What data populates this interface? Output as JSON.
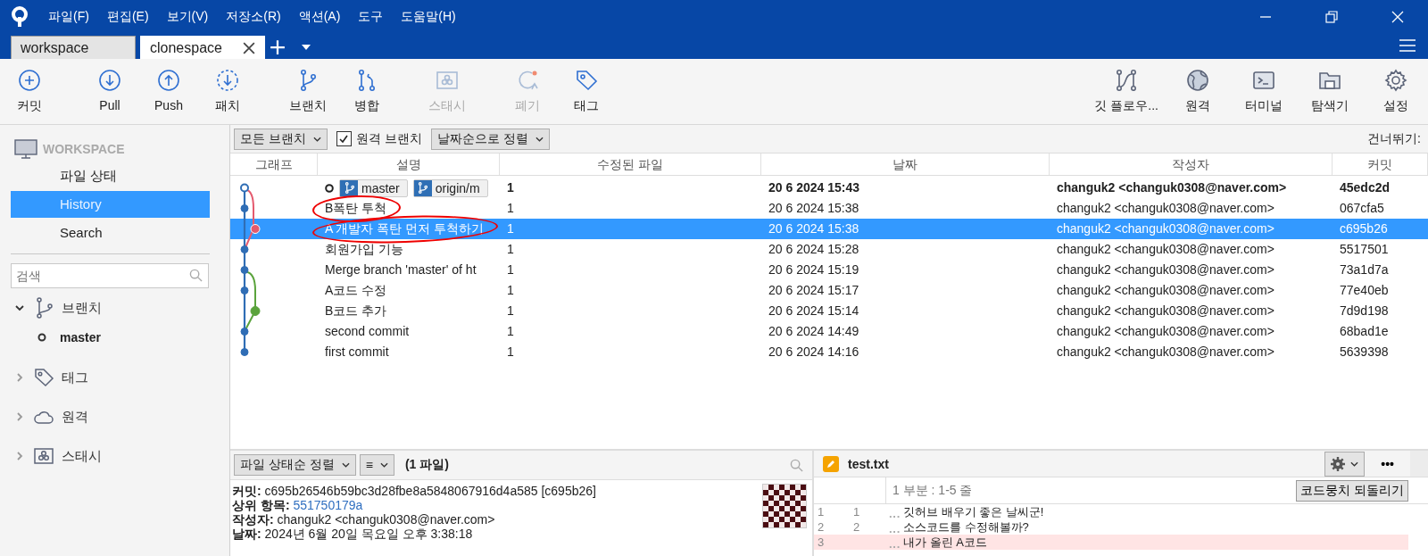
{
  "menu": [
    "파일(F)",
    "편집(E)",
    "보기(V)",
    "저장소(R)",
    "액션(A)",
    "도구",
    "도움말(H)"
  ],
  "tabs": [
    {
      "label": "workspace",
      "selected": false
    },
    {
      "label": "clonespace",
      "selected": true
    }
  ],
  "toolbar_left": [
    {
      "label": "커밋",
      "disabled": false
    },
    {
      "label": "Pull",
      "disabled": false
    },
    {
      "label": "Push",
      "disabled": false
    },
    {
      "label": "패치",
      "disabled": false
    },
    {
      "label": "브랜치",
      "disabled": false
    },
    {
      "label": "병합",
      "disabled": false
    },
    {
      "label": "스태시",
      "disabled": true
    },
    {
      "label": "폐기",
      "disabled": true
    },
    {
      "label": "태그",
      "disabled": false
    }
  ],
  "toolbar_right": [
    {
      "label": "깃 플로우..."
    },
    {
      "label": "원격"
    },
    {
      "label": "터미널"
    },
    {
      "label": "탐색기"
    },
    {
      "label": "설정"
    }
  ],
  "sidebar": {
    "workspace": "WORKSPACE",
    "items": [
      {
        "label": "파일 상태",
        "selected": false
      },
      {
        "label": "History",
        "selected": true
      },
      {
        "label": "Search",
        "selected": false
      }
    ],
    "search": {
      "placeholder": "검색"
    },
    "sections": [
      {
        "label": "브랜치",
        "expanded": true,
        "children": [
          {
            "label": "master",
            "current": true
          }
        ]
      },
      {
        "label": "태그",
        "expanded": false
      },
      {
        "label": "원격",
        "expanded": false
      },
      {
        "label": "스태시",
        "expanded": false
      }
    ]
  },
  "filter": {
    "branches": "모든 브랜치",
    "remote_label": "원격 브랜치",
    "remote_checked": true,
    "sort": "날짜순으로 정렬",
    "skip": "건너뛰기:"
  },
  "table": {
    "columns": [
      "그래프",
      "설명",
      "수정된 파일",
      "날짜",
      "작성자",
      "커밋"
    ],
    "rows": [
      {
        "refs": [
          "master",
          "origin/m"
        ],
        "description": "",
        "files": "1",
        "date": "20 6 2024 15:43",
        "author": "changuk2 <changuk0308@naver.com>",
        "commit": "45edc2d",
        "head": true,
        "selected": false,
        "circled": false
      },
      {
        "refs": [],
        "description": "B폭탄 투척",
        "files": "1",
        "date": "20 6 2024 15:38",
        "author": "changuk2 <changuk0308@naver.com>",
        "commit": "067cfa5",
        "head": false,
        "selected": false,
        "circled": true
      },
      {
        "refs": [],
        "description": "A 개발자 폭탄 먼저 투척하기",
        "files": "1",
        "date": "20 6 2024 15:38",
        "author": "changuk2 <changuk0308@naver.com>",
        "commit": "c695b26",
        "head": false,
        "selected": true,
        "circled": true
      },
      {
        "refs": [],
        "description": "회원가입 기능",
        "files": "1",
        "date": "20 6 2024 15:28",
        "author": "changuk2 <changuk0308@naver.com>",
        "commit": "5517501",
        "head": false,
        "selected": false,
        "circled": false
      },
      {
        "refs": [],
        "description": "Merge branch 'master' of ht",
        "files": "1",
        "date": "20 6 2024 15:19",
        "author": "changuk2 <changuk0308@naver.com>",
        "commit": "73a1d7a",
        "head": false,
        "selected": false,
        "circled": false
      },
      {
        "refs": [],
        "description": "A코드 수정",
        "files": "1",
        "date": "20 6 2024 15:17",
        "author": "changuk2 <changuk0308@naver.com>",
        "commit": "77e40eb",
        "head": false,
        "selected": false,
        "circled": false
      },
      {
        "refs": [],
        "description": "B코드 추가",
        "files": "1",
        "date": "20 6 2024 15:14",
        "author": "changuk2 <changuk0308@naver.com>",
        "commit": "7d9d198",
        "head": false,
        "selected": false,
        "circled": false
      },
      {
        "refs": [],
        "description": "second commit",
        "files": "1",
        "date": "20 6 2024 14:49",
        "author": "changuk2 <changuk0308@naver.com>",
        "commit": "68bad1e",
        "head": false,
        "selected": false,
        "circled": false
      },
      {
        "refs": [],
        "description": "first commit",
        "files": "1",
        "date": "20 6 2024 14:16",
        "author": "changuk2 <changuk0308@naver.com>",
        "commit": "5639398",
        "head": false,
        "selected": false,
        "circled": false
      }
    ]
  },
  "files_panel": {
    "sort": "파일 상태순 정렬",
    "view": "≡",
    "count": "(1 파일)",
    "details": [
      {
        "label": "커밋:",
        "value": "c695b26546b59bc3d28fbe8a5848067916d4a585 [c695b26]",
        "link": false
      },
      {
        "label": "상위 항목:",
        "value": "551750179a",
        "link": true
      },
      {
        "label": "작성자:",
        "value": "changuk2 <changuk0308@naver.com>",
        "link": false
      },
      {
        "label": "날짜:",
        "value": "2024년 6월 20일 목요일 오후 3:38:18",
        "link": false
      }
    ]
  },
  "diff": {
    "file": "test.txt",
    "hunk": "1 부분 : 1-5 줄",
    "revert": "코드뭉치 되돌리기",
    "more": "•••",
    "lines": [
      {
        "old": "1",
        "new": "1",
        "whitespace": "···",
        "text": "깃허브 배우기 좋은 날씨군!",
        "kind": "context"
      },
      {
        "old": "2",
        "new": "2",
        "whitespace": "···",
        "text": "소스코드를 수정해볼까?",
        "kind": "context"
      },
      {
        "old": "3",
        "whitespace": "···",
        "text": "내가 올린 A코드",
        "kind": "removed"
      }
    ]
  }
}
